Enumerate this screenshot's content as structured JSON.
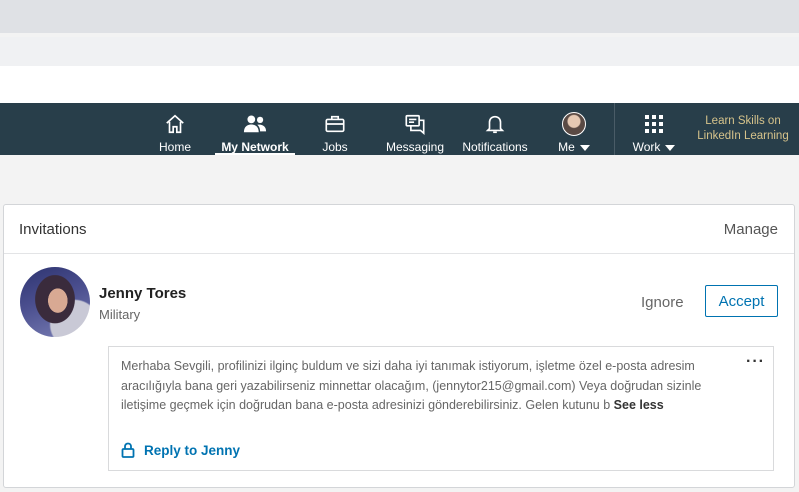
{
  "nav": {
    "items": [
      {
        "key": "home",
        "label": "Home",
        "icon": "home-icon"
      },
      {
        "key": "network",
        "label": "My Network",
        "icon": "people-icon"
      },
      {
        "key": "jobs",
        "label": "Jobs",
        "icon": "briefcase-icon"
      },
      {
        "key": "messaging",
        "label": "Messaging",
        "icon": "chat-icon"
      },
      {
        "key": "notifications",
        "label": "Notifications",
        "icon": "bell-icon"
      },
      {
        "key": "me",
        "label": "Me",
        "icon": "avatar"
      },
      {
        "key": "work",
        "label": "Work",
        "icon": "grid-icon"
      }
    ],
    "learning_line1": "Learn Skills on",
    "learning_line2": "LinkedIn Learning"
  },
  "colors": {
    "nav_bg": "#283e4a",
    "accent": "#0073b1",
    "learning_gold": "#d6c38b"
  },
  "invitations": {
    "title": "Invitations",
    "manage_label": "Manage",
    "item": {
      "name": "Jenny Tores",
      "headline": "Military",
      "ignore_label": "Ignore",
      "accept_label": "Accept",
      "message": "Merhaba Sevgili, profilinizi ilginç buldum ve sizi daha iyi tanımak istiyorum, işletme özel e-posta adresim aracılığıyla bana geri yazabilirseniz minnettar olacağım, (jennytor215@gmail.com) Veya doğrudan sizinle iletişime geçmek için doğrudan bana e-posta adresinizi gönderebilirsiniz. Gelen kutunu b",
      "see_less_label": "See less",
      "more_label": "···",
      "reply_label": "Reply to Jenny"
    }
  }
}
